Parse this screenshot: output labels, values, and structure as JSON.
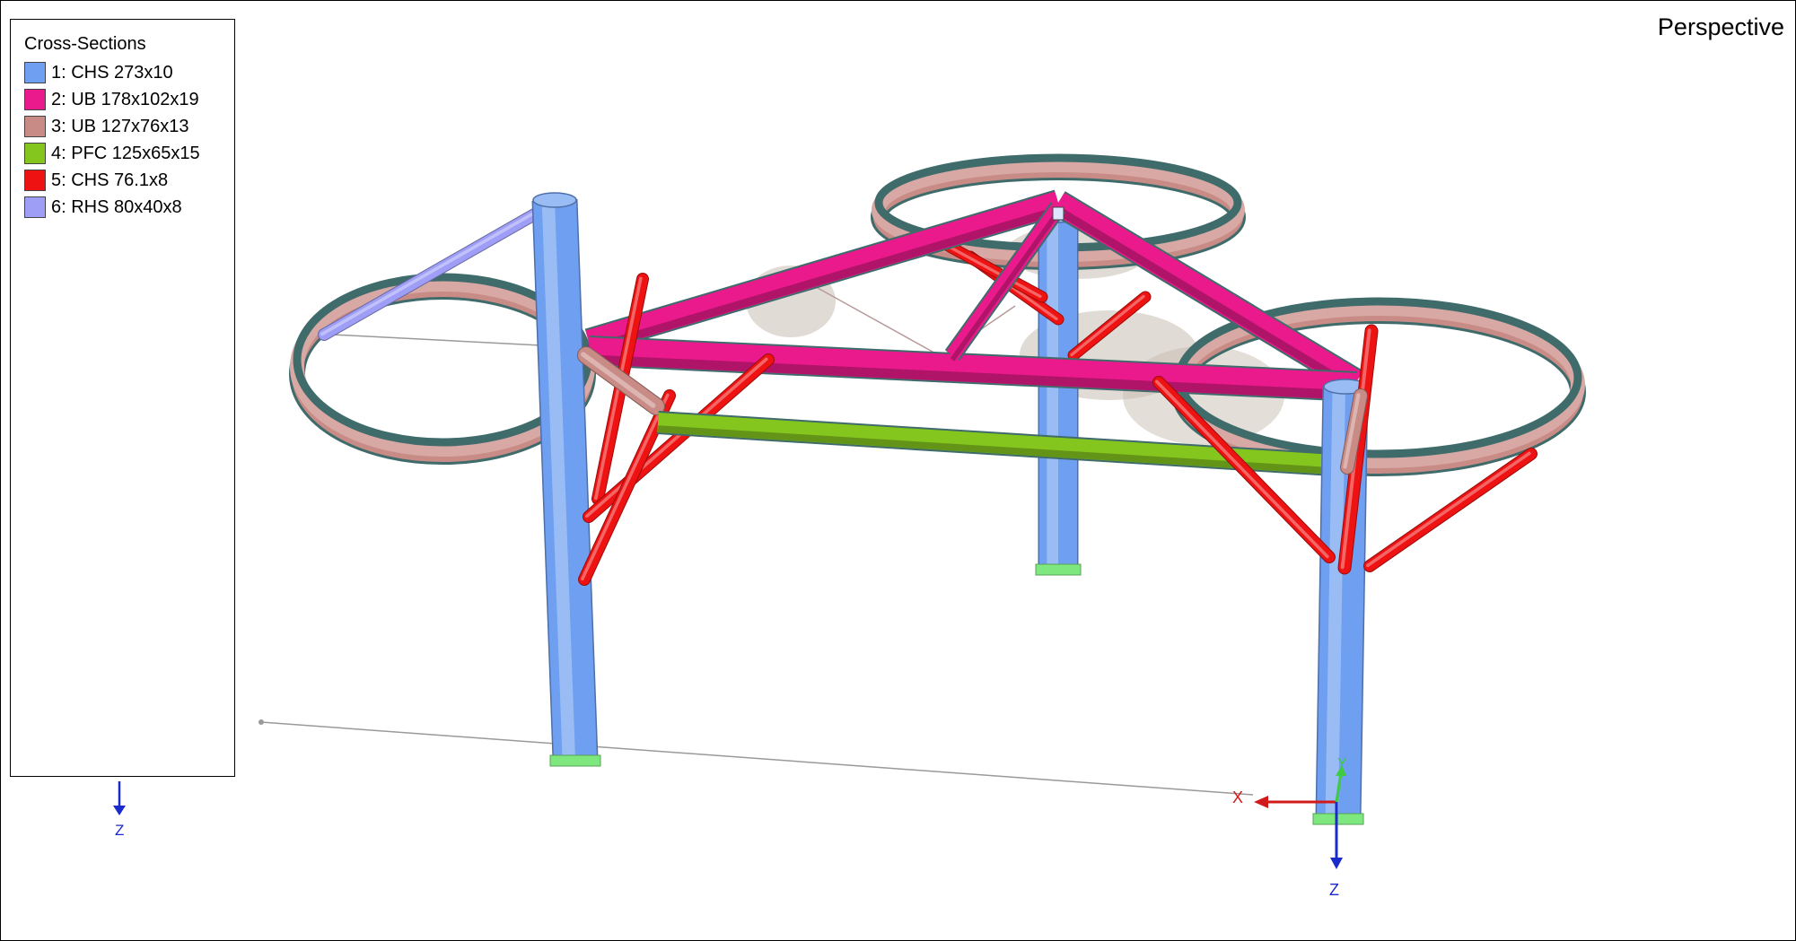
{
  "view": {
    "mode_label": "Perspective"
  },
  "legend": {
    "title": "Cross-Sections",
    "items": [
      {
        "label": "1: CHS 273x10",
        "color": "#6f9ff0"
      },
      {
        "label": "2: UB 178x102x19",
        "color": "#ea1a8c"
      },
      {
        "label": "3: UB 127x76x13",
        "color": "#c98b86"
      },
      {
        "label": "4: PFC 125x65x15",
        "color": "#84c51e"
      },
      {
        "label": "5: CHS 76.1x8",
        "color": "#ee1212"
      },
      {
        "label": "6: RHS 80x40x8",
        "color": "#9e9ef7"
      }
    ]
  },
  "axes": {
    "legend_axis_label": "Z",
    "origin_axis_labels": {
      "x": "X",
      "y": "Y",
      "z": "Z"
    },
    "colors": {
      "x": "#d21a1a",
      "y": "#3ecb3e",
      "z": "#1a2acb"
    }
  },
  "colors": {
    "support": "#7ee87e",
    "edge": "#3f6b6b",
    "helper_line": "#9a9a9a",
    "ghost": "#c8bdb2"
  }
}
